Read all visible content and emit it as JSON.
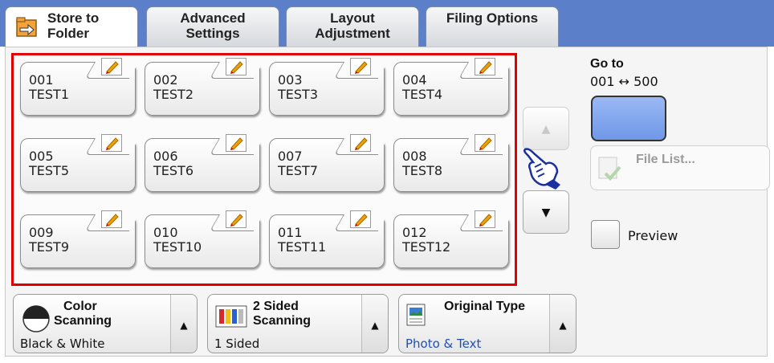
{
  "tabs": [
    {
      "line1": "Store to",
      "line2": "Folder",
      "active": true
    },
    {
      "line1": "Advanced",
      "line2": "Settings"
    },
    {
      "line1": "Layout",
      "line2": "Adjustment"
    },
    {
      "line1": "Filing Options",
      "line2": ""
    }
  ],
  "folders": [
    {
      "number": "001",
      "name": "TEST1"
    },
    {
      "number": "002",
      "name": "TEST2"
    },
    {
      "number": "003",
      "name": "TEST3"
    },
    {
      "number": "004",
      "name": "TEST4"
    },
    {
      "number": "005",
      "name": "TEST5"
    },
    {
      "number": "006",
      "name": "TEST6"
    },
    {
      "number": "007",
      "name": "TEST7"
    },
    {
      "number": "008",
      "name": "TEST8"
    },
    {
      "number": "009",
      "name": "TEST9"
    },
    {
      "number": "010",
      "name": "TEST10"
    },
    {
      "number": "011",
      "name": "TEST11"
    },
    {
      "number": "012",
      "name": "TEST12"
    }
  ],
  "scroll": {
    "up": "▲",
    "down": "▼"
  },
  "goto": {
    "label": "Go to",
    "range": "001 ↔ 500"
  },
  "file_list": {
    "label": "File List..."
  },
  "preview": {
    "label": "Preview"
  },
  "bottom": {
    "color": {
      "line1": "Color",
      "line2": "Scanning",
      "value": "Black & White"
    },
    "sided": {
      "line1": "2 Sided",
      "line2": "Scanning",
      "value": "1 Sided"
    },
    "original": {
      "line1": "Original Type",
      "value": "Photo & Text"
    }
  },
  "colors": {
    "accent_blue": "#5b7fc9",
    "highlight_red": "#e00000"
  }
}
